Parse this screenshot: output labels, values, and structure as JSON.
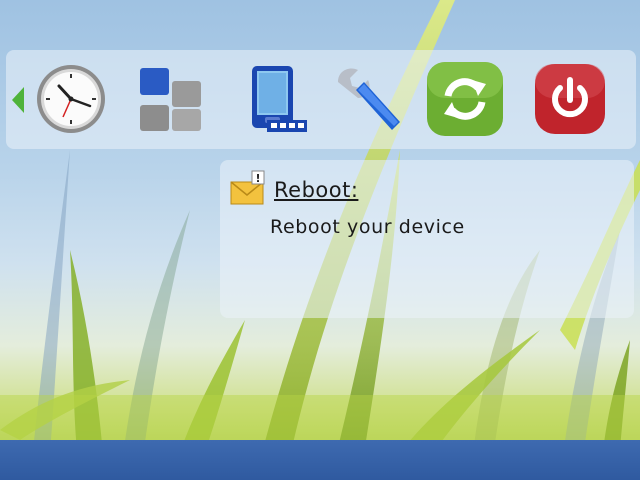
{
  "toolbar": {
    "items": [
      {
        "icon": "clock-icon"
      },
      {
        "icon": "apps-grid-icon"
      },
      {
        "icon": "phone-connect-icon"
      },
      {
        "icon": "wrench-icon"
      },
      {
        "icon": "refresh-icon"
      },
      {
        "icon": "power-icon"
      }
    ],
    "selected_item": "refresh-icon"
  },
  "info": {
    "icon": "envelope-alert-icon",
    "title": "Reboot:",
    "description": "Reboot your device"
  },
  "colors": {
    "refresh_button": "#6cae32",
    "power_button": "#c0242c",
    "bottom_bar": "#2f5aa0",
    "nav_arrow": "#4fb33a"
  }
}
